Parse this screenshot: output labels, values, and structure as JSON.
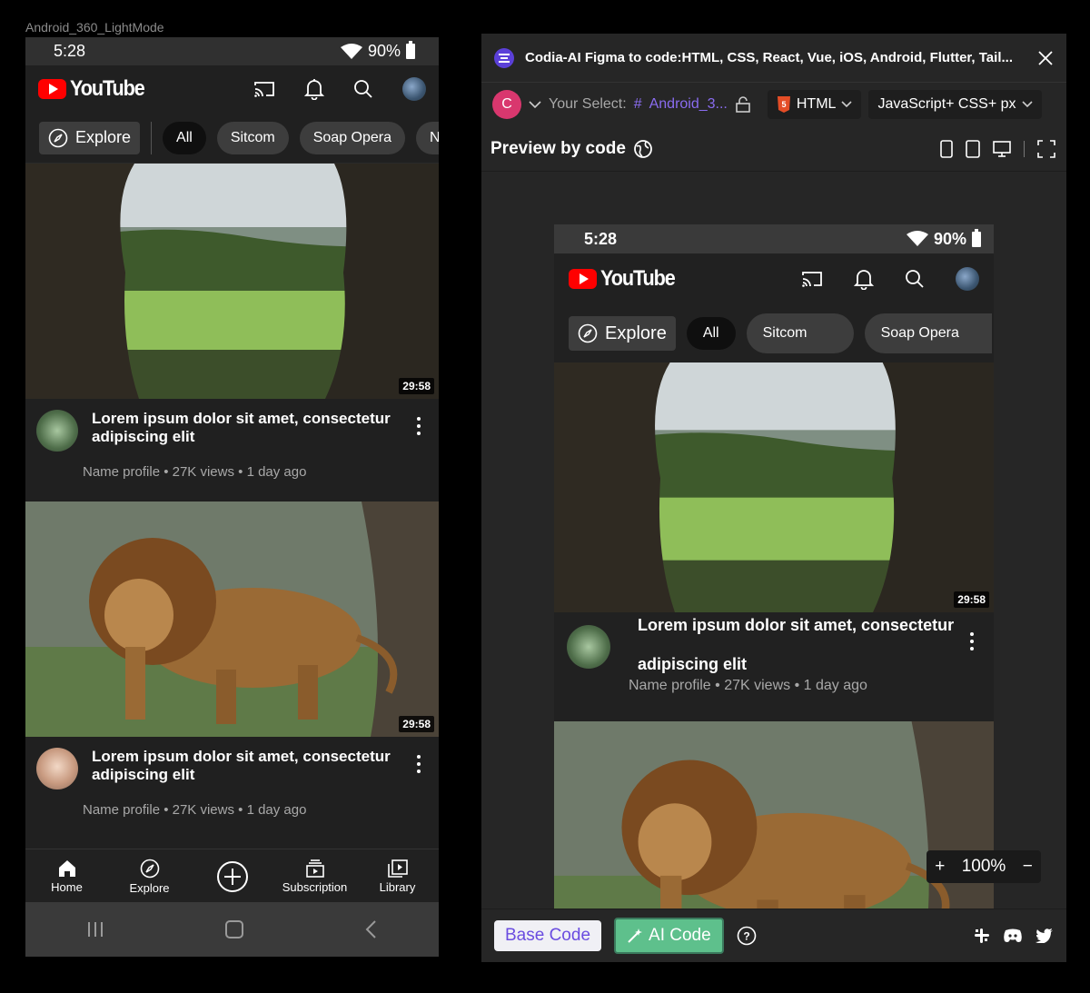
{
  "frame_label": "Android_360_LightMode",
  "phone": {
    "status": {
      "time": "5:28",
      "battery": "90%"
    },
    "brand": "YouTube",
    "chips": {
      "explore": "Explore",
      "items": [
        "All",
        "Sitcom",
        "Soap Opera",
        "New"
      ]
    },
    "videos": [
      {
        "title": "Lorem ipsum dolor sit amet, consectetur adipiscing elit",
        "subtitle": "Name profile • 27K views • 1 day ago",
        "duration": "29:58"
      },
      {
        "title": "Lorem ipsum dolor sit amet, consectetur adipiscing elit",
        "subtitle": "Name profile • 27K views • 1 day ago",
        "duration": "29:58"
      }
    ],
    "nav": [
      "Home",
      "Explore",
      "",
      "Subscription",
      "Library"
    ]
  },
  "panel": {
    "title": "Codia-AI Figma to code:HTML, CSS, React, Vue, iOS, Android, Flutter, Tail...",
    "user_initial": "C",
    "select_label": "Your Select:",
    "select_value": "Android_3...",
    "lang": "HTML",
    "stack": "JavaScript+ CSS+ px",
    "preview_label": "Preview by code",
    "preview": {
      "time": "5:28",
      "battery": "90%",
      "brand": "YouTube",
      "chips": {
        "explore": "Explore",
        "items": [
          "All",
          "Sitcom",
          "Soap Opera"
        ]
      },
      "video": {
        "title_line1": "Lorem ipsum dolor sit amet, consectetur",
        "title_line2": "adipiscing elit",
        "subtitle": "Name profile • 27K views • 1 day ago",
        "duration": "29:58"
      }
    },
    "zoom": "100%",
    "base_code": "Base Code",
    "ai_code": "AI Code"
  }
}
